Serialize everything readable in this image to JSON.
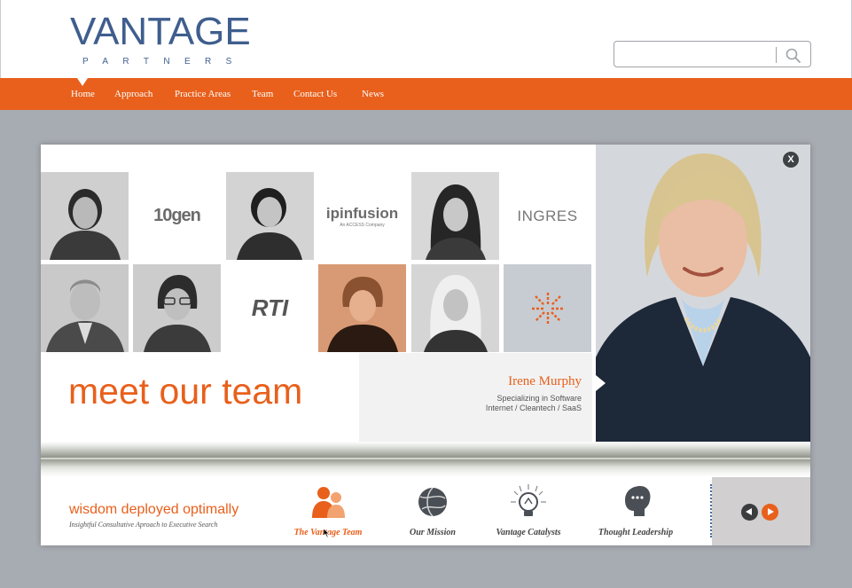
{
  "logo": {
    "wordmark": "VANTAGE",
    "subword": "PARTNERS"
  },
  "search": {
    "value": "",
    "placeholder": ""
  },
  "nav": {
    "items": [
      {
        "label": "Home",
        "active": true
      },
      {
        "label": "Approach"
      },
      {
        "label": "Practice Areas"
      },
      {
        "label": "Team"
      },
      {
        "label": "Contact Us"
      },
      {
        "label": "News"
      }
    ]
  },
  "modal": {
    "close_label": "X",
    "tiles": {
      "logo_10gen": "10gen",
      "logo_ipinfusion": "ipinfusion",
      "logo_ipinfusion_sub": "An ACCESS Company",
      "logo_ingres": "INGRES",
      "logo_rti": "RTI"
    },
    "headline": "meet our team",
    "person": {
      "name": "Irene Murphy",
      "specialty": "Specializing in Software",
      "sectors": "Internet / Cleantech / SaaS"
    },
    "tagline": "wisdom deployed optimally",
    "subtagline": "Insightful Consultative Aproach to Executive Search",
    "tabs": [
      {
        "label": "The Vantage Team",
        "icon": "team-icon",
        "active": true
      },
      {
        "label": "Our Mission",
        "icon": "globe-icon"
      },
      {
        "label": "Vantage Catalysts",
        "icon": "lightbulb-icon"
      },
      {
        "label": "Thought Leadership",
        "icon": "speech-head-icon"
      }
    ]
  },
  "colors": {
    "accent": "#e8601c",
    "brand_blue": "#3f5e8e",
    "background": "#a7acb2"
  }
}
